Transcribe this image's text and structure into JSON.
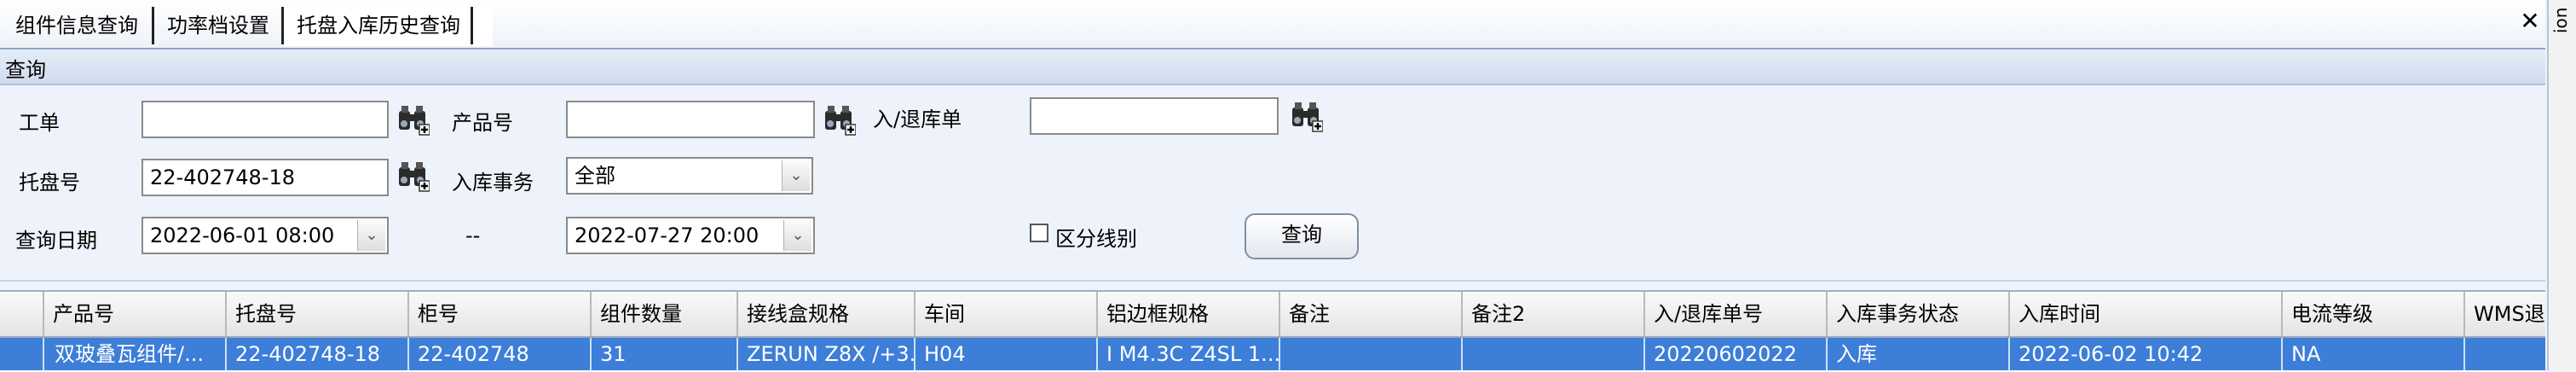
{
  "tabs": [
    {
      "label": "组件信息查询"
    },
    {
      "label": "功率档设置"
    },
    {
      "label": "托盘入库历史查询"
    }
  ],
  "side_strip_text": "ion",
  "group_title": "查询",
  "form": {
    "work_order": {
      "label": "工单",
      "value": ""
    },
    "product_no": {
      "label": "产品号",
      "value": ""
    },
    "io_order": {
      "label": "入/退库单",
      "value": ""
    },
    "pallet_no": {
      "label": "托盘号",
      "value": "22-402748-18"
    },
    "in_transaction": {
      "label": "入库事务",
      "selected": "全部"
    },
    "query_date": {
      "label": "查询日期",
      "from": "2022-06-01 08:00",
      "separator": "--",
      "to": "2022-07-27 20:00"
    },
    "distinguish_line": {
      "label": "区分线别",
      "checked": false
    },
    "query_button": "查询"
  },
  "grid": {
    "columns": [
      "产品号",
      "托盘号",
      "柜号",
      "组件数量",
      "接线盒规格",
      "车间",
      "铝边框规格",
      "备注",
      "备注2",
      "入/退库单号",
      "入库事务状态",
      "入库时间",
      "电流等级",
      "WMS退"
    ],
    "rows": [
      [
        "双玻叠瓦组件/...",
        "22-402748-18",
        "22-402748",
        "31",
        "ZERUN Z8X /+3...",
        "H04",
        "I M4.3C Z4SL 1...",
        "",
        "",
        "20220602022",
        "入库",
        "2022-06-02 10:42",
        "NA",
        ""
      ]
    ]
  },
  "colors": {
    "selection": "#3d7ed8",
    "header_gradient_end": "#cfdcee",
    "background": "#eef3fb"
  },
  "icons": {
    "lookup": "binoculars-icon",
    "close": "close-icon"
  }
}
